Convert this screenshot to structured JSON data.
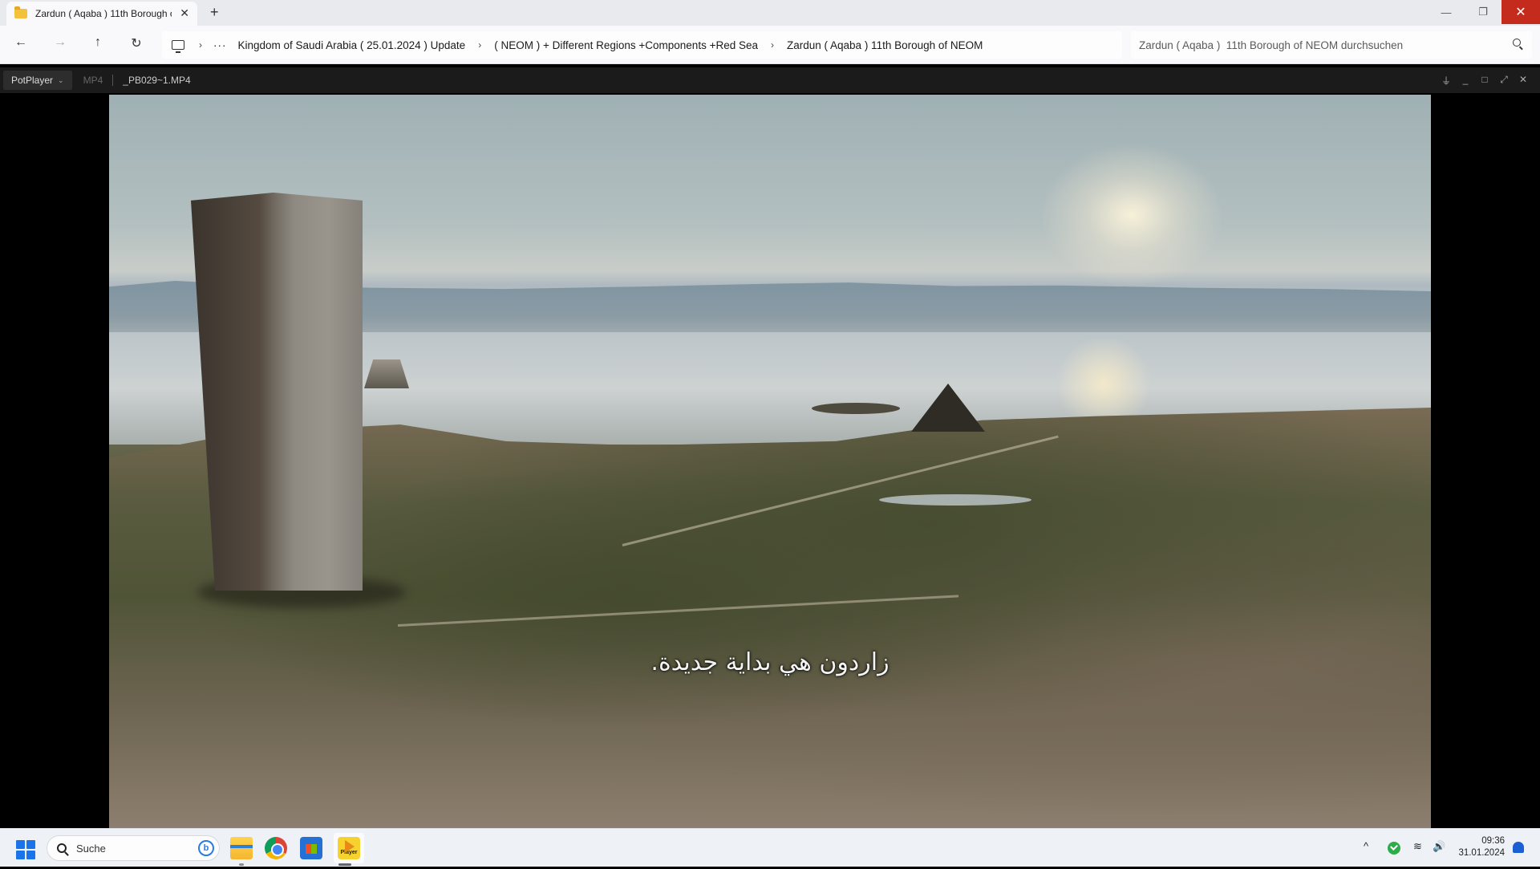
{
  "explorer": {
    "tab_title": "Zardun ( Aqaba )  11th Borough of NEOM",
    "tab_close": "✕",
    "new_tab": "+",
    "window_controls": {
      "minimize": "—",
      "maximize": "❐",
      "close": "✕"
    },
    "nav": {
      "back": "←",
      "forward": "→",
      "up": "↑",
      "refresh": "↻"
    },
    "breadcrumb": {
      "more": "···",
      "items": [
        "Kingdom of Saudi Arabia ( 25.01.2024 ) Update",
        "( NEOM ) + Different Regions +Components +Red Sea",
        "Zardun ( Aqaba )  11th Borough of NEOM"
      ],
      "separator": "›"
    },
    "search_placeholder": "Zardun ( Aqaba )  11th Borough of NEOM durchsuchen"
  },
  "player": {
    "brand": "PotPlayer",
    "brand_caret": "⌄",
    "format": "MP4",
    "filename": "_PB029~1.MP4",
    "controls": {
      "pin": "⏚",
      "minimize": "_",
      "maximize": "□",
      "fullscreen": "⤢",
      "close": "✕"
    },
    "subtitle": "زاردون هي بداية جديدة."
  },
  "taskbar": {
    "search_label": "Suche",
    "bing_label": "b",
    "pot_label": "Player",
    "tray_chevron": "^",
    "wifi": "≋",
    "volume": "🔊",
    "time": "09:36",
    "date": "31.01.2024"
  },
  "colors": {
    "close_button": "#c42b1c",
    "start_blue": "#1a73e8",
    "security_green": "#2bad49"
  }
}
